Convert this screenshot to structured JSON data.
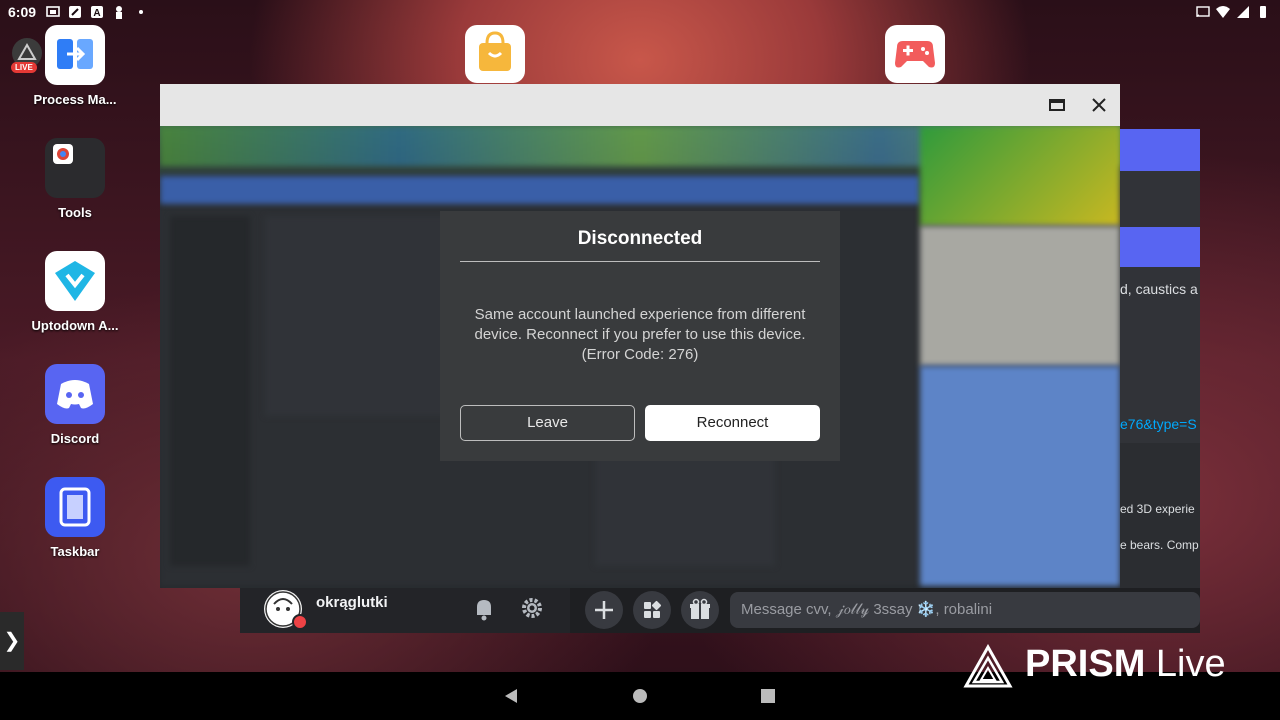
{
  "status_bar": {
    "time": "6:09"
  },
  "desktop": {
    "live_badge": "LIVE",
    "icons": [
      {
        "label": "Process Ma..."
      },
      {
        "label": "Tools"
      },
      {
        "label": "Uptodown A..."
      },
      {
        "label": "Discord"
      },
      {
        "label": "Taskbar"
      }
    ]
  },
  "dialog": {
    "title": "Disconnected",
    "message": "Same account launched experience from different device. Reconnect if you prefer to use this device. (Error Code: 276)",
    "leave_label": "Leave",
    "reconnect_label": "Reconnect"
  },
  "discord": {
    "username": "okrąglutki",
    "message_placeholder": "Message cvv, 𝒿𝑜𝓁𝓁𝓎 3ssay ❄️, robalini",
    "side_snippets": [
      "d, caustics a",
      "e76&type=S",
      "ed 3D experie",
      "e bears. Comp"
    ]
  },
  "watermark": {
    "brand": "PRISM",
    "product": "Live"
  },
  "colors": {
    "dialog_bg": "#393b3d",
    "discord_dark": "#1e1f22",
    "discord_blue": "#5865f2"
  }
}
